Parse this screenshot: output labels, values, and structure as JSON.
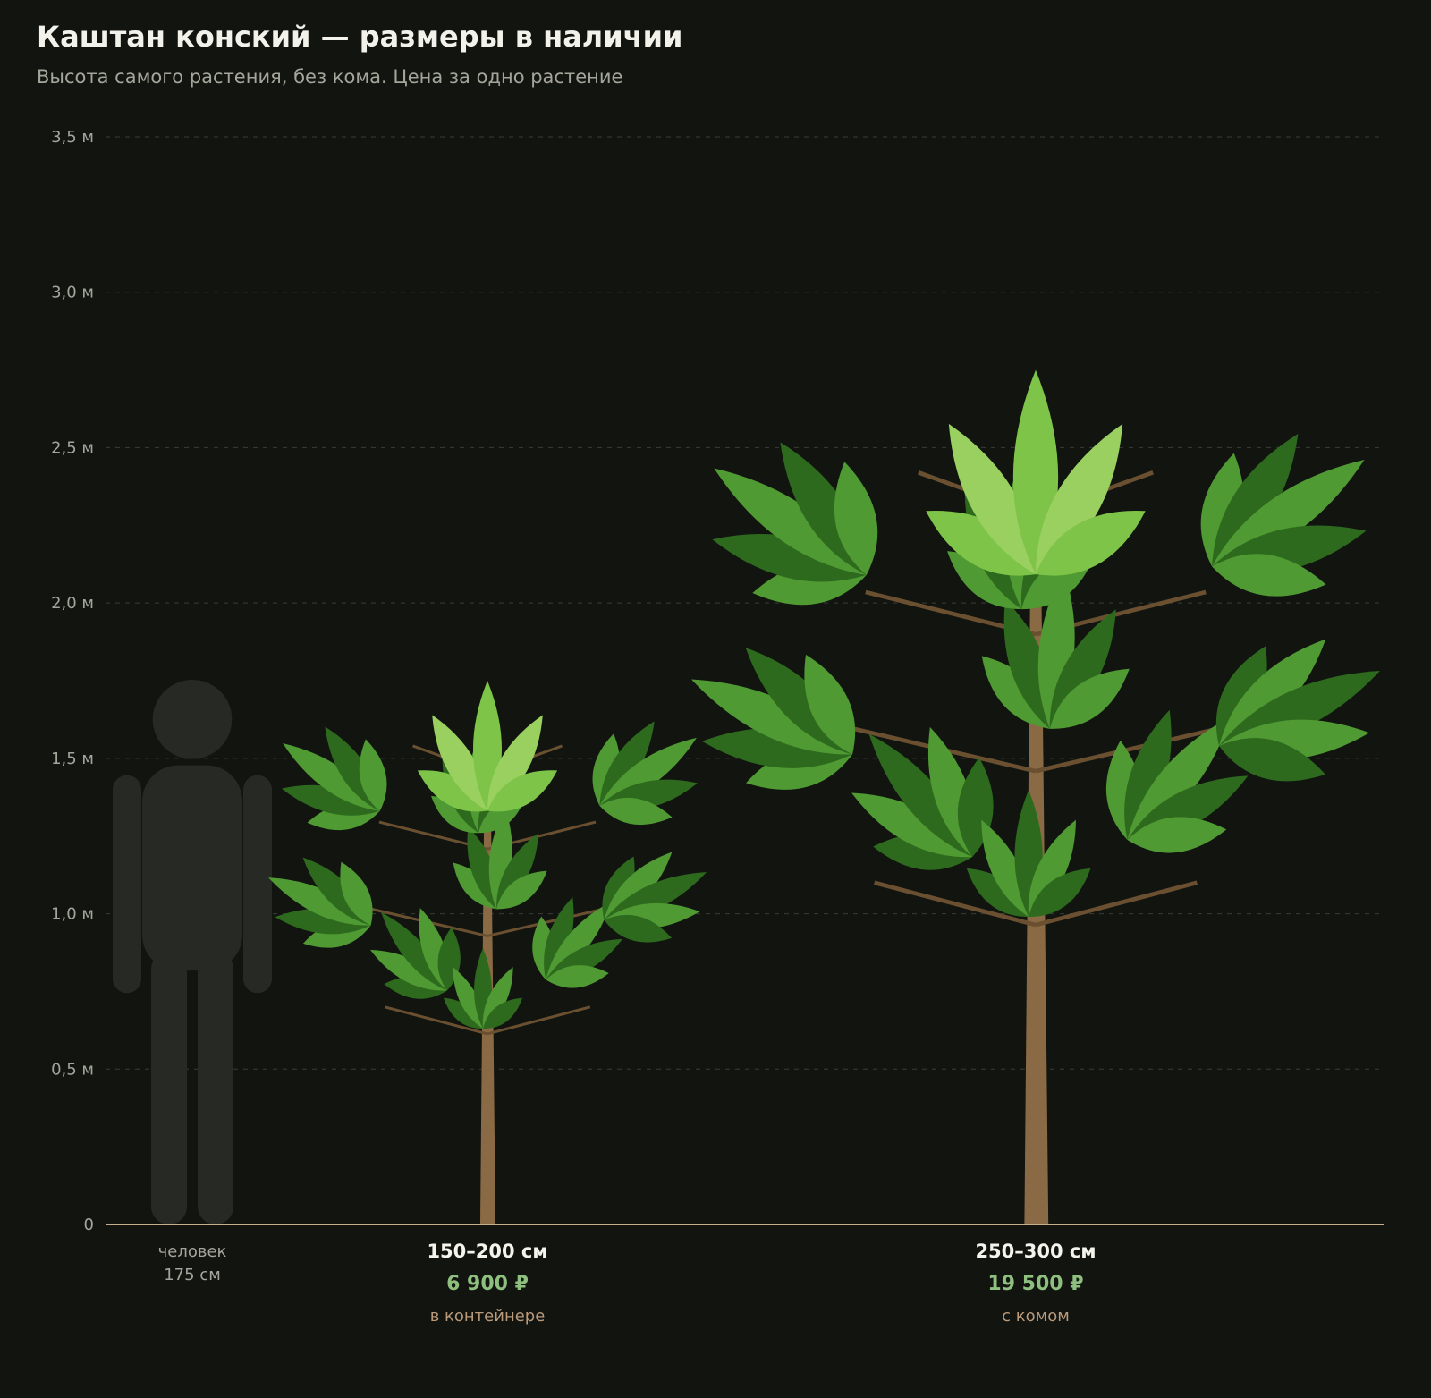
{
  "header": {
    "title": "Каштан конский — размеры в наличии",
    "subtitle": "Высота самого растения, без кома. Цена за одно растение"
  },
  "colors": {
    "background": "#121410",
    "grid": "#3a3c34",
    "baseline": "#c8ae8a",
    "human": "#272925",
    "price": "#8fbf7e",
    "pack": "#b99a7a",
    "leaf_light": "#7ec448",
    "leaf_mid": "#4f9a32",
    "leaf_dark": "#2d6a1e",
    "trunk": "#8a6a44"
  },
  "chart_data": {
    "type": "bar",
    "ylim": [
      0,
      3.5
    ],
    "yticks": [
      0,
      0.5,
      1.0,
      1.5,
      2.0,
      2.5,
      3.0,
      3.5
    ],
    "ytick_labels": [
      "0",
      "0,5 м",
      "1,0 м",
      "1,5 м",
      "2,0 м",
      "2,5 м",
      "3,0 м",
      "3,5 м"
    ],
    "grid": true,
    "reference": {
      "label": "человек",
      "sublabel": "175 см",
      "value": 1.75,
      "icon": "human-silhouette-icon"
    },
    "categories": [
      "150–200 см",
      "250–300 см"
    ],
    "values": [
      1.75,
      2.75
    ],
    "prices": [
      "6 900 ₽",
      "19 500 ₽"
    ],
    "packaging": [
      "в контейнере",
      "с комом"
    ],
    "icons": [
      "chestnut-tree-icon",
      "chestnut-tree-icon"
    ]
  }
}
